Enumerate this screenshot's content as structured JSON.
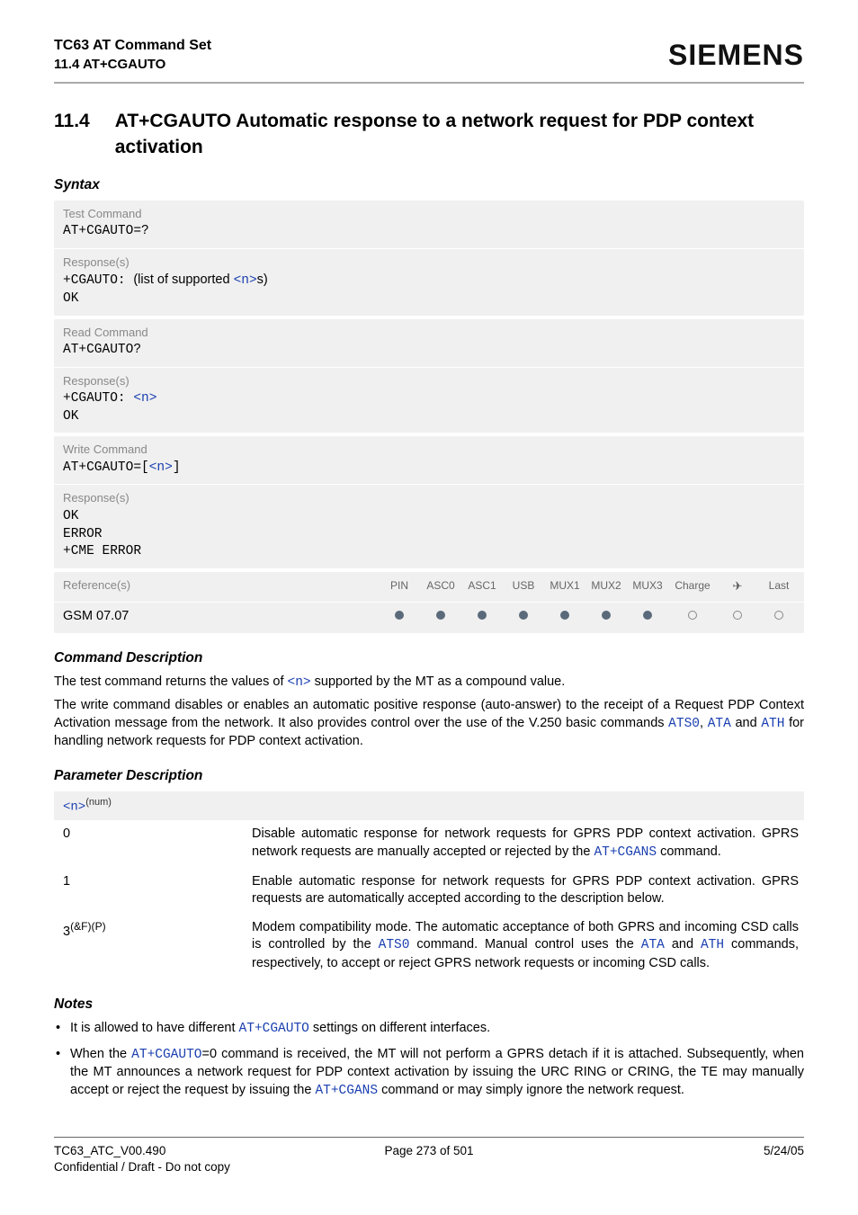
{
  "header": {
    "doc_title": "TC63 AT Command Set",
    "section_ref": "11.4 AT+CGAUTO",
    "brand": "SIEMENS"
  },
  "title": {
    "number": "11.4",
    "text": "AT+CGAUTO   Automatic response to a network request for PDP context activation"
  },
  "syntax_label": "Syntax",
  "syntax": {
    "test": {
      "label": "Test Command",
      "cmd": "AT+CGAUTO=?",
      "resp_label": "Response(s)",
      "resp_prefix": "+CGAUTO: ",
      "resp_text": "(list of supported ",
      "resp_param": "<n>",
      "resp_suffix": "s)",
      "ok": "OK"
    },
    "read": {
      "label": "Read Command",
      "cmd": "AT+CGAUTO?",
      "resp_label": "Response(s)",
      "resp_prefix": "+CGAUTO: ",
      "resp_param": "<n>",
      "ok": "OK"
    },
    "write": {
      "label": "Write Command",
      "cmd_prefix": "AT+CGAUTO=[",
      "cmd_param": "<n>",
      "cmd_suffix": "]",
      "resp_label": "Response(s)",
      "ok": "OK",
      "error": "ERROR",
      "cme": "+CME ERROR"
    },
    "reference": {
      "label": "Reference(s)",
      "value": "GSM 07.07",
      "cols": [
        "PIN",
        "ASC0",
        "ASC1",
        "USB",
        "MUX1",
        "MUX2",
        "MUX3",
        "Charge",
        "✈",
        "Last"
      ],
      "filled": [
        true,
        true,
        true,
        true,
        true,
        true,
        true,
        false,
        false,
        false
      ]
    }
  },
  "cmd_desc": {
    "heading": "Command Description",
    "p1a": "The test command returns the values of ",
    "p1_param": "<n>",
    "p1b": " supported by the MT as a compound value.",
    "p2a": "The write command disables or enables an automatic positive response (auto-answer) to the receipt of a Request PDP Context Activation message from the network. It also provides control over the use of the V.250 basic commands ",
    "p2_l1": "ATS0",
    "p2_sep1": ", ",
    "p2_l2": "ATA",
    "p2_sep2": " and ",
    "p2_l3": "ATH",
    "p2b": " for handling network requests for PDP context activation."
  },
  "param_desc": {
    "heading": "Parameter Description",
    "header_param": "<n>",
    "header_sup": "(num)",
    "rows": [
      {
        "key": "0",
        "text_a": "Disable automatic response for network requests for GPRS PDP context activation. GPRS network requests are manually accepted or rejected by the ",
        "link": "AT+CGANS",
        "text_b": " command."
      },
      {
        "key": "1",
        "text_a": "Enable automatic response for network requests for GPRS PDP context activation. GPRS requests are automatically accepted according to the description below.",
        "link": "",
        "text_b": ""
      },
      {
        "key": "3",
        "key_sup": "(&F)(P)",
        "text_a": "Modem compatibility mode. The automatic acceptance of both GPRS and incoming CSD calls is controlled by the ",
        "link": "ATS0",
        "text_b": " command. Manual control uses the ",
        "link2": "ATA",
        "text_c": " and ",
        "link3": "ATH",
        "text_d": " commands, respectively, to accept or reject GPRS network requests or incoming CSD calls."
      }
    ]
  },
  "notes": {
    "heading": "Notes",
    "items": [
      {
        "a": "It is allowed to have different ",
        "l1": "AT+CGAUTO",
        "b": " settings on different interfaces."
      },
      {
        "a": "When the ",
        "l1": "AT+CGAUTO",
        "b": "=0 command is received, the MT will not perform a GPRS detach if it is attached. Subsequently, when the MT announces a network request for PDP context activation by issuing the URC RING or CRING, the TE may manually accept or reject the request by issuing the ",
        "l2": "AT+CGANS",
        "c": " command or may simply ignore the network request."
      }
    ]
  },
  "footer": {
    "left1": "TC63_ATC_V00.490",
    "left2": "Confidential / Draft - Do not copy",
    "mid": "Page 273 of 501",
    "right": "5/24/05"
  }
}
